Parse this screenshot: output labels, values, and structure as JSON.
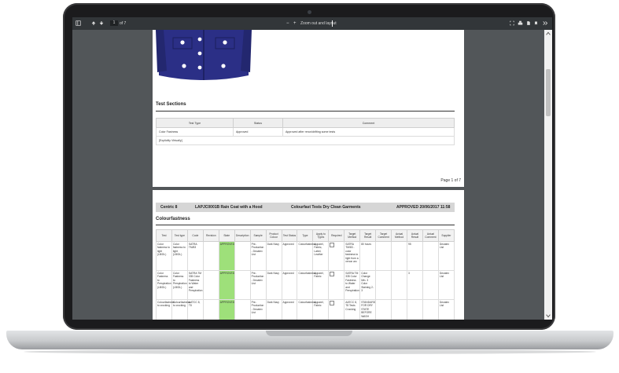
{
  "toolbar": {
    "page_current": "1",
    "page_of": "of 7",
    "zoom_out": "−",
    "zoom_in": "+",
    "doc_name": "Zoom out and layout"
  },
  "page1": {
    "sections_title": "Test Sections",
    "table_headers": [
      "Test Type",
      "Status",
      "Comment"
    ],
    "rows": [
      [
        "Color Fastness",
        "Approved",
        "Approved after rerun/drifting some tests"
      ],
      [
        "[Explicitly Virtually]",
        "",
        ""
      ]
    ],
    "page_label": "Page 1 of 7"
  },
  "page2": {
    "banner": {
      "left": "Centric 8",
      "style": "LAPJC0001B Rain Coat with a Hood",
      "test": "Colourfast Tests Dry Clean Garments",
      "status": "APPROVED 20/06/2017 11:58"
    },
    "section_title": "Colourfastness",
    "headers": [
      "Test",
      "Test type",
      "Code",
      "Revision",
      "State",
      "Description",
      "Sample",
      "Product Colour",
      "Test Status",
      "Type",
      "Apply to Types",
      "Required",
      "Target Method",
      "Target Result",
      "Target Comment",
      "Actual Method",
      "Actual Result",
      "Actual Comment",
      "Supplier"
    ],
    "rows": [
      [
        "Color fastness to light (LB/DL)",
        "Color fastness to light (LB/DL)",
        "SATRA TM/83",
        "",
        "APPROVED",
        "",
        "Pre-Production - Decatex List",
        "Dark Navy",
        "Approved",
        "Colourfastness",
        "Apparel, Fabric, Label, Leather",
        "",
        "SATRA TM/83 - color fastness to light from a xenon arc",
        "80 hours",
        "",
        "",
        "95",
        "",
        "Decatex List"
      ],
      [
        "Color Fastness to Perspiration (LB/DL)",
        "Color Fastness to Perspiration (LB/DL)",
        "SATRA TM 335 Color Fastness to Water and Perspiration",
        "",
        "APPROVED",
        "",
        "Pre-Production - Decatex List",
        "Dark Navy",
        "Approved",
        "Colourfastness",
        "Apparel, Fabric",
        "",
        "SATRA TM 335 Color Fastness to Water and Perspiration",
        "Color Change Min. 3 Color Staining 2-3",
        "",
        "",
        "3",
        "",
        "Decatex List"
      ],
      [
        "Colourfastness to crocking",
        "Colourfastness to crocking",
        "AATCC 8, T8",
        "",
        "APPROVED",
        "",
        "Pre-Production - Decatex List",
        "Dark Navy",
        "Approved",
        "Colourfastness",
        "Apparel, Fabric",
        "",
        "AATCC 8, T8 Tests Crocking",
        "STANDARD FOR DRY STATE BEFORE WASH",
        "",
        "",
        "",
        "",
        "Decatex List"
      ]
    ]
  },
  "colors": {
    "screen_bg": "#525659",
    "toolbar_bg": "#323639",
    "approved_green": "#9ee07a",
    "jacket_navy": "#2b2f86",
    "banner_gray": "#d6d6d6"
  },
  "icons": [
    "sidebar-toggle-icon",
    "arrow-up-icon",
    "arrow-down-icon",
    "fit-page-icon",
    "print-icon",
    "download-icon",
    "bookmark-icon",
    "more-icon",
    "chevron-up-icon",
    "chevron-down-icon"
  ]
}
